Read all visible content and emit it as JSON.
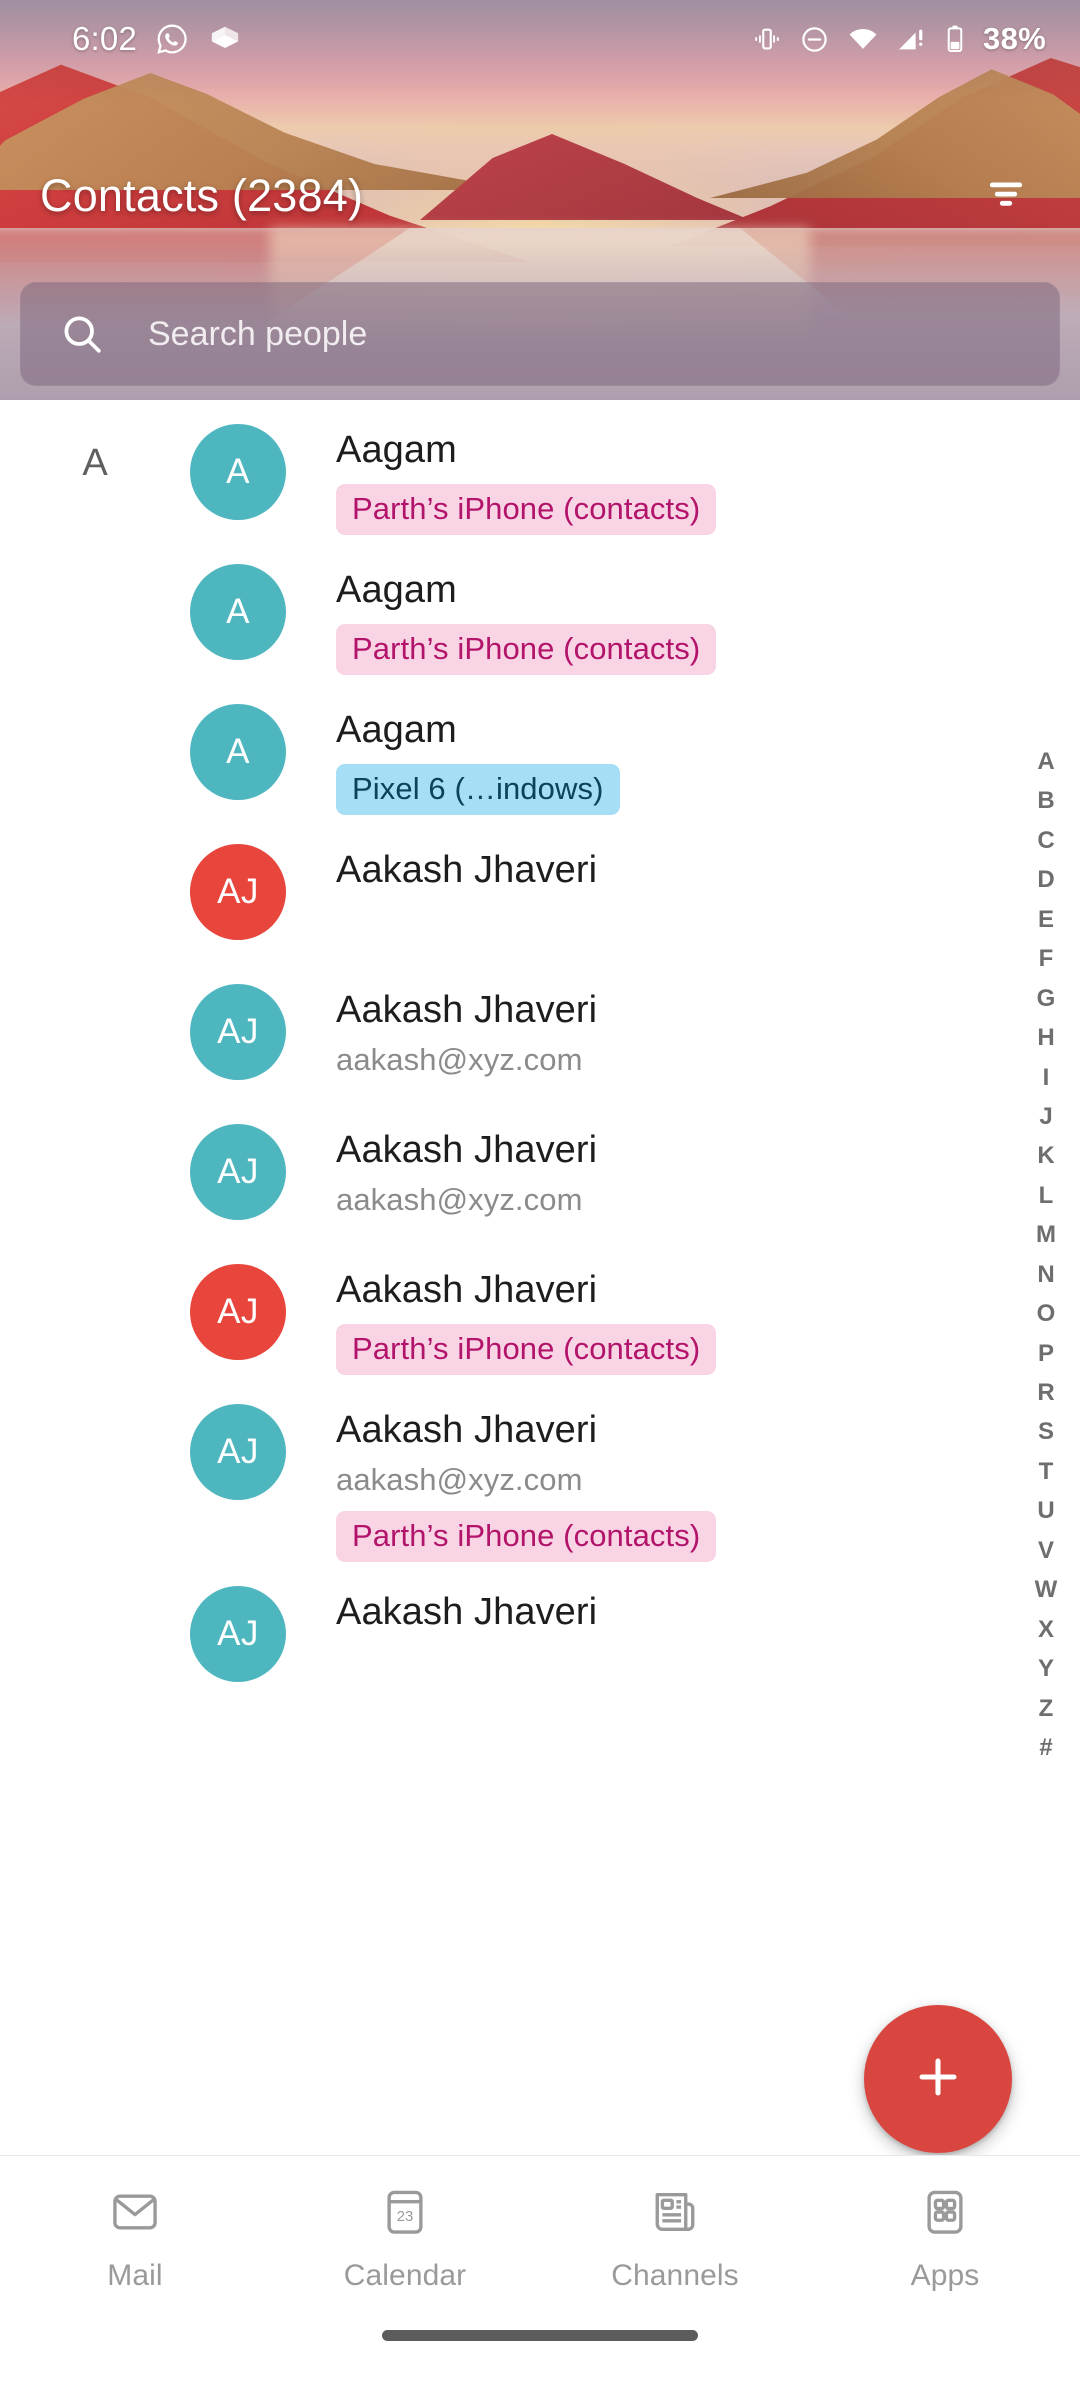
{
  "status_bar": {
    "time": "6:02",
    "battery_percent": "38%",
    "left_icons": [
      "whatsapp-icon",
      "package-delivery-icon"
    ],
    "right_icons": [
      "vibrate-icon",
      "do-not-disturb-icon",
      "wifi-icon",
      "cellular-signal-warning-icon",
      "battery-icon"
    ]
  },
  "header": {
    "title": "Contacts (2384)",
    "filter_icon": "filter-icon"
  },
  "search": {
    "placeholder": "Search people",
    "value": "",
    "icon": "search-icon"
  },
  "section_header": "A",
  "contacts": [
    {
      "section": "A",
      "initials": "A",
      "avatar_color": "#4db6be",
      "name": "Aagam",
      "email": "",
      "badge": "Parth’s iPhone (contacts)",
      "badge_style": "pink"
    },
    {
      "section": "",
      "initials": "A",
      "avatar_color": "#4db6be",
      "name": "Aagam",
      "email": "",
      "badge": "Parth’s iPhone (contacts)",
      "badge_style": "pink"
    },
    {
      "section": "",
      "initials": "A",
      "avatar_color": "#4db6be",
      "name": "Aagam",
      "email": "",
      "badge": "Pixel 6 (…indows)",
      "badge_style": "blue"
    },
    {
      "section": "",
      "initials": "AJ",
      "avatar_color": "#e8453c",
      "name": "Aakash Jhaveri",
      "email": "",
      "badge": "",
      "badge_style": ""
    },
    {
      "section": "",
      "initials": "AJ",
      "avatar_color": "#4db6be",
      "name": "Aakash Jhaveri",
      "email": "aakash@xyz.com",
      "badge": "",
      "badge_style": ""
    },
    {
      "section": "",
      "initials": "AJ",
      "avatar_color": "#4db6be",
      "name": "Aakash Jhaveri",
      "email": "aakash@xyz.com",
      "badge": "",
      "badge_style": ""
    },
    {
      "section": "",
      "initials": "AJ",
      "avatar_color": "#e8453c",
      "name": "Aakash Jhaveri",
      "email": "",
      "badge": "Parth’s iPhone (contacts)",
      "badge_style": "pink"
    },
    {
      "section": "",
      "initials": "AJ",
      "avatar_color": "#4db6be",
      "name": "Aakash Jhaveri",
      "email": "aakash@xyz.com",
      "badge": "Parth’s iPhone (contacts)",
      "badge_style": "pink"
    },
    {
      "section": "",
      "initials": "AJ",
      "avatar_color": "#4db6be",
      "name": "Aakash Jhaveri",
      "email": "",
      "badge": "",
      "badge_style": ""
    }
  ],
  "az_index": [
    "A",
    "B",
    "C",
    "D",
    "E",
    "F",
    "G",
    "H",
    "I",
    "J",
    "K",
    "L",
    "M",
    "N",
    "O",
    "P",
    "R",
    "S",
    "T",
    "U",
    "V",
    "W",
    "X",
    "Y",
    "Z",
    "#"
  ],
  "fab": {
    "icon": "plus-icon",
    "color": "#d9453f"
  },
  "bottom_nav": [
    {
      "label": "Mail",
      "icon": "mail-icon"
    },
    {
      "label": "Calendar",
      "icon": "calendar-icon",
      "day": "23"
    },
    {
      "label": "Channels",
      "icon": "channels-icon"
    },
    {
      "label": "Apps",
      "icon": "apps-grid-icon"
    }
  ],
  "colors": {
    "accent_red": "#d9453f",
    "avatar_teal": "#4db6be",
    "avatar_red": "#e8453c",
    "badge_pink_bg": "#f8d4e4",
    "badge_pink_text": "#b3146b",
    "badge_blue_bg": "#a5def5",
    "badge_blue_text": "#0b4358"
  }
}
